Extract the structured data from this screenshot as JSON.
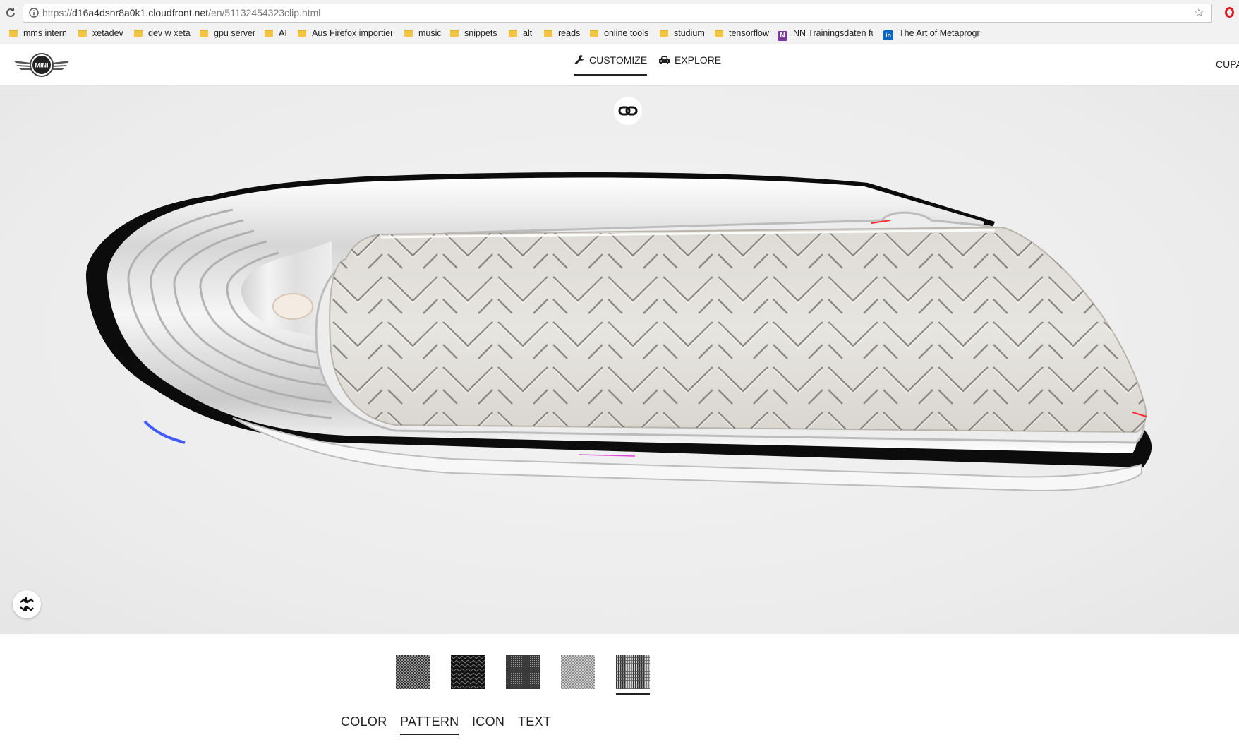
{
  "browser": {
    "url_scheme": "https://",
    "url_host": "d16a4dsnr8a0k1.cloudfront.net",
    "url_path": "/en/51132454323clip.html",
    "bookmarks": [
      {
        "label": "mms intern",
        "icon": "folder-icon"
      },
      {
        "label": "xetadev",
        "icon": "folder-icon"
      },
      {
        "label": "dev w xeta",
        "icon": "folder-icon"
      },
      {
        "label": "gpu server",
        "icon": "folder-icon"
      },
      {
        "label": "AI",
        "icon": "folder-icon"
      },
      {
        "label": "Aus Firefox importier",
        "icon": "folder-icon"
      },
      {
        "label": "music",
        "icon": "folder-icon"
      },
      {
        "label": "snippets",
        "icon": "folder-icon"
      },
      {
        "label": "alt",
        "icon": "folder-icon"
      },
      {
        "label": "reads",
        "icon": "folder-icon"
      },
      {
        "label": "online tools",
        "icon": "folder-icon"
      },
      {
        "label": "studium",
        "icon": "folder-icon"
      },
      {
        "label": "tensorflow",
        "icon": "folder-icon"
      },
      {
        "label": "NN Trainingsdaten fu",
        "icon": "onenote-icon"
      },
      {
        "label": "The Art of Metaprogr",
        "icon": "linkedin-icon"
      }
    ]
  },
  "header": {
    "logo_text": "MINI",
    "nav": {
      "customize": "CUSTOMIZE",
      "explore": "EXPLORE"
    },
    "right_text": "CUPA"
  },
  "viewer": {
    "link_icon": "link-icon",
    "explode_icon": "explode-icon"
  },
  "customizer": {
    "patterns": [
      {
        "name": "checker-fine",
        "selected": false
      },
      {
        "name": "herringbone-dark",
        "selected": false
      },
      {
        "name": "dots-dark",
        "selected": false
      },
      {
        "name": "checker-light",
        "selected": false
      },
      {
        "name": "stripes-vertical",
        "selected": true
      }
    ],
    "tabs": {
      "color": "COLOR",
      "pattern": "PATTERN",
      "icon": "ICON",
      "text": "TEXT"
    },
    "active_tab": "pattern"
  },
  "colors": {
    "accent": "#222222",
    "viewer_bg": "#ededed",
    "clip_surface": "#e4e2dd",
    "opera_red": "#e01b24"
  }
}
